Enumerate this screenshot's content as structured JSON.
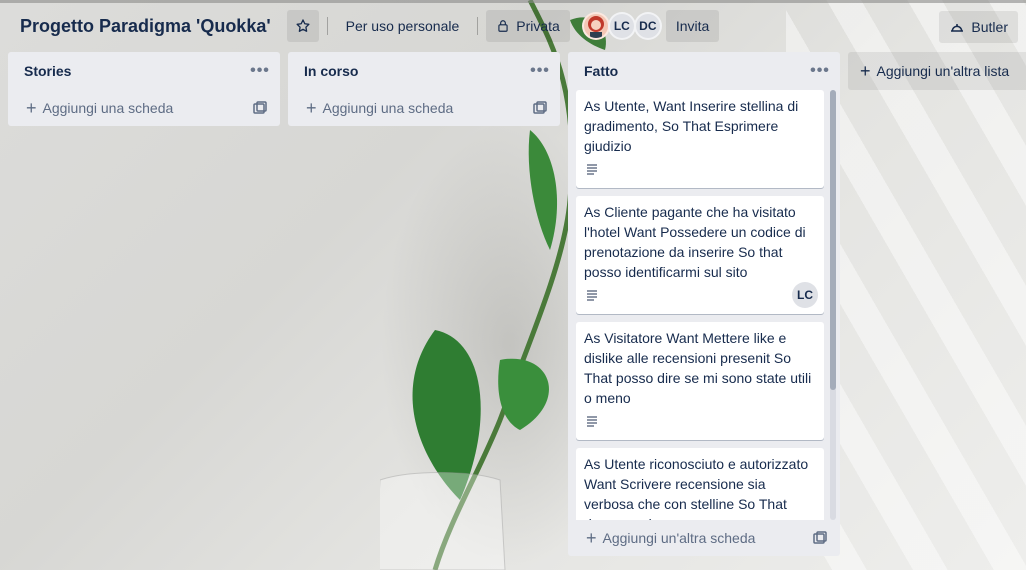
{
  "board": {
    "title": "Progetto Paradigma 'Quokka'",
    "workspace_label": "Per uso personale",
    "visibility_label": "Privata",
    "invite_label": "Invita",
    "butler_label": "Butler",
    "members": [
      {
        "initials": "",
        "kind": "photo"
      },
      {
        "initials": "LC",
        "kind": "initials"
      },
      {
        "initials": "DC",
        "kind": "initials"
      }
    ]
  },
  "lists": [
    {
      "title": "Stories",
      "add_card_label": "Aggiungi una scheda",
      "cards": []
    },
    {
      "title": "In corso",
      "add_card_label": "Aggiungi una scheda",
      "cards": []
    },
    {
      "title": "Fatto",
      "add_card_label": "Aggiungi un'altra scheda",
      "cards": [
        {
          "title": "As Utente, Want Inserire stellina di gradimento, So That Esprimere giudizio",
          "has_description": true,
          "member": ""
        },
        {
          "title": "As Cliente pagante che ha visitato l'hotel Want Possedere un codice di prenotazione da inserire So that posso identificarmi sul sito",
          "has_description": true,
          "member": "LC"
        },
        {
          "title": "As Visitatore Want Mettere like e dislike alle recensioni presenit So That posso dire se mi sono state utili o meno",
          "has_description": true,
          "member": ""
        },
        {
          "title": "As Utente riconosciuto e autorizzato Want Scrivere recensione sia verbosa che con stelline So That dare pareri",
          "has_description": false,
          "member": ""
        }
      ]
    }
  ],
  "add_list_label": "Aggiungi un'altra lista",
  "icons": {
    "star": "star-icon",
    "lock": "lock-icon",
    "butler": "butler-icon",
    "more": "more-icon",
    "plus": "plus-icon",
    "template": "template-icon",
    "description": "description-icon"
  }
}
